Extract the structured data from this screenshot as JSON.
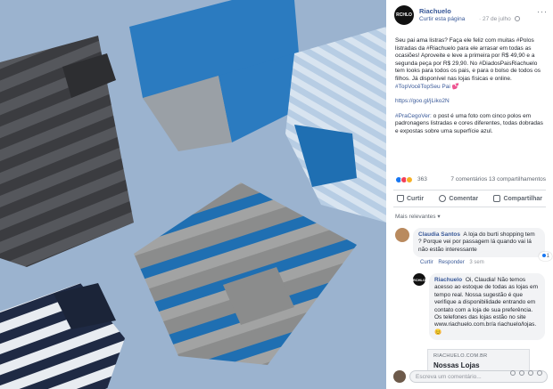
{
  "post": {
    "avatar_text": "RCHLO",
    "page_name": "Riachuelo",
    "follow_label": "Curtir esta página",
    "separator": "·",
    "date": "27 de julho",
    "paragraph1_a": "Seu pai ama listras? Faça ele feliz com muitas #Polos listradas da #Riachuelo para ele arrasar em todas as ocasiões! Aproveite e leve a primeira por R$ 49,90 e a segunda peça por R$ 29,90. No #DiadosPaisRiachuelo tem looks para todos os pais, e para o bolso de todos os filhos. Já disponível nas lojas físicas e online.",
    "paragraph1_hashtag": "#TopVocêTopSeu Pai",
    "link": "https://goo.gl/jLiko2N",
    "paragraph3_hashtag": "#PraCegoVer:",
    "paragraph3_text": "o post é uma foto com cinco polos em padronagens listradas e cores diferentes, todas dobradas e expostas sobre uma superfície azul.",
    "reaction_count": "363",
    "comments_shares": "7 comentários  13 compartilhamentos",
    "relevance_label": "Mais relevantes ▾"
  },
  "actions": {
    "like": "Curtir",
    "comment": "Comentar",
    "share": "Compartilhar"
  },
  "comment1": {
    "author": "Claudia Santos",
    "text": "A loja do burti shopping tem ? Porque vei por passagem lá quando vai lá não estão interessante",
    "reaction": "1",
    "like": "Curtir",
    "reply": "Responder",
    "time": "3 sem"
  },
  "reply1": {
    "avatar_text": "RCHLO",
    "author": "Riachuelo",
    "text": "Oi, Claudia! Não temos acesso ao estoque de todas as lojas em tempo real. Nossa sugestão é que verifique a disponibilidade entrando em contato com a loja de sua preferência. Os telefones das lojas estão no site www.riachuelo.com.br/a riachuelo/lojas.",
    "preview_domain": "RIACHUELO.COM.BR",
    "preview_title": "Nossas Lojas"
  },
  "write_comment_placeholder": "Escreva um comentário...",
  "colors": {
    "link_blue": "#385898",
    "photo_bg": "#9bb3cf"
  }
}
